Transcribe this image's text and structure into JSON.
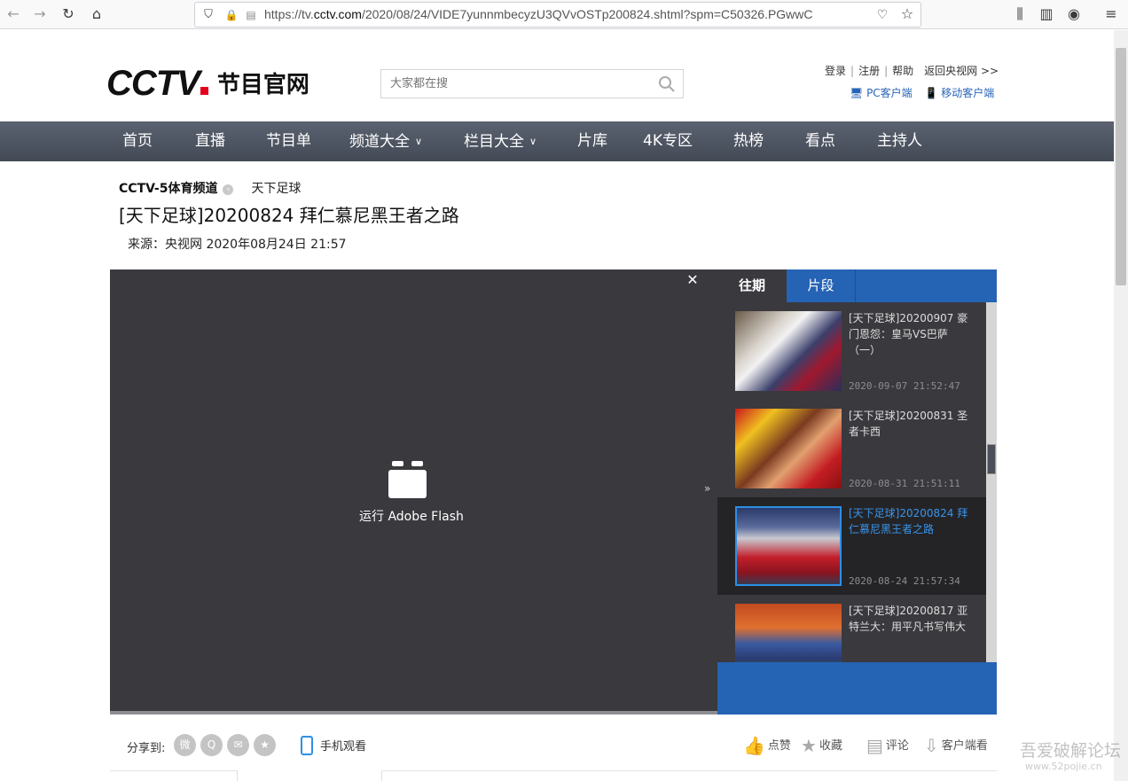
{
  "browser": {
    "url_prefix": "https://tv.",
    "url_domain": "cctv.com",
    "url_path": "/2020/08/24/VIDE7yunnmbecyzU3QVvOSTp200824.shtml?spm=C50326.PGwwC"
  },
  "header": {
    "logo_text": "CCTV",
    "logo_sub": "节目官网",
    "search_placeholder": "大家都在搜",
    "links": [
      "登录",
      "注册",
      "帮助",
      "返回央视网 >>"
    ],
    "pc_client": "PC客户端",
    "mobile_client": "移动客户端"
  },
  "nav": {
    "items": [
      "首页",
      "直播",
      "节目单",
      "频道大全",
      "栏目大全",
      "片库",
      "4K专区",
      "热榜",
      "看点",
      "主持人"
    ]
  },
  "video": {
    "channel": "CCTV-5体育频道",
    "column": "天下足球",
    "title": "[天下足球]20200824 拜仁慕尼黑王者之路",
    "source": "来源：央视网  2020年08月24日 21:57",
    "flash_label": "运行 Adobe Flash"
  },
  "panel": {
    "tabs": [
      "往期",
      "片段"
    ],
    "items": [
      {
        "title": "[天下足球]20200907 豪门恩怨：皇马VS巴萨（一）",
        "date": "2020-09-07 21:52:47",
        "active": false
      },
      {
        "title": "[天下足球]20200831 圣者卡西",
        "date": "2020-08-31 21:51:11",
        "active": false
      },
      {
        "title": "[天下足球]20200824 拜仁慕尼黑王者之路",
        "date": "2020-08-24 21:57:34",
        "active": true
      },
      {
        "title": "[天下足球]20200817 亚特兰大：用平凡书写伟大",
        "date": "",
        "active": false
      }
    ]
  },
  "share": {
    "label": "分享到:",
    "mobile_watch": "手机观看",
    "actions": [
      "点赞",
      "收藏",
      "评论",
      "客户端看"
    ]
  },
  "watermark": {
    "text": "吾爱破解论坛",
    "url": "www.52pojie.cn"
  },
  "colors": {
    "nav_bg": "#4d5460",
    "accent_blue": "#2563b4",
    "active_title": "#3a94ea",
    "logo_red": "#e3001b"
  }
}
